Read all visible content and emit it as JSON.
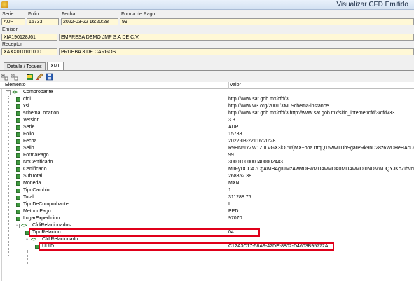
{
  "window": {
    "title": "Visualizar CFD Emitido"
  },
  "header": {
    "serie_label": "Serie",
    "serie_value": "AUP",
    "folio_label": "Folio",
    "folio_value": "15733",
    "fecha_label": "Fecha",
    "fecha_value": "2022-03-22 16:20:28",
    "forma_pago_label": "Forma de Pago",
    "forma_pago_value": "99",
    "emisor_label": "Emisor",
    "emisor_rfc": "XIA190128J61",
    "emisor_nombre": "EMPRESA DEMO JMP S.A DE C.V.",
    "receptor_label": "Receptor",
    "receptor_rfc": "XAXX010101000",
    "receptor_nombre": "PRUEBA 3  DE CARGOS"
  },
  "tabs": [
    {
      "label": "Detalle / Totales",
      "active": false
    },
    {
      "label": "XML",
      "active": true
    }
  ],
  "toolbar": {
    "icons": [
      "expand-all-icon",
      "collapse-all-icon",
      "open-icon",
      "edit-icon",
      "save-icon"
    ]
  },
  "grid": {
    "col_elemento": "Elemento",
    "col_valor": "Valor",
    "rows": [
      {
        "name": "Comprobante",
        "value": "",
        "type": "node"
      },
      {
        "name": "cfdi",
        "value": "http://www.sat.gob.mx/cfd/3",
        "type": "attr"
      },
      {
        "name": "xsi",
        "value": "http://www.w3.org/2001/XMLSchema-instance",
        "type": "attr"
      },
      {
        "name": "schemaLocation",
        "value": "http://www.sat.gob.mx/cfd/3 http://www.sat.gob.mx/sitio_internet/cfd/3/cfdv33.",
        "type": "attr"
      },
      {
        "name": "Version",
        "value": "3.3",
        "type": "attr"
      },
      {
        "name": "Serie",
        "value": "AUP",
        "type": "attr"
      },
      {
        "name": "Folio",
        "value": "15733",
        "type": "attr"
      },
      {
        "name": "Fecha",
        "value": "2022-03-22T16:20:28",
        "type": "attr"
      },
      {
        "name": "Sello",
        "value": "R9HN6IYZW1ZuLVGX3iO7w/jMX+boaTtrqQ15wwTDbSgarPRk9nD28z6WDHeHAcUQ",
        "type": "attr"
      },
      {
        "name": "FormaPago",
        "value": "99",
        "type": "attr"
      },
      {
        "name": "NoCertificado",
        "value": "30001000000400002443",
        "type": "attr"
      },
      {
        "name": "Certificado",
        "value": "MIIFyDCCA7CgAwIBAgIUMzAwMDEwMDAwMDA0MDAwMDI0NDMwDQYJKoZIhvcN",
        "type": "attr"
      },
      {
        "name": "SubTotal",
        "value": "268352.38",
        "type": "attr"
      },
      {
        "name": "Moneda",
        "value": "MXN",
        "type": "attr"
      },
      {
        "name": "TipoCambio",
        "value": "1",
        "type": "attr"
      },
      {
        "name": "Total",
        "value": "311288.76",
        "type": "attr"
      },
      {
        "name": "TipoDeComprobante",
        "value": "I",
        "type": "attr"
      },
      {
        "name": "MetodoPago",
        "value": "PPD",
        "type": "attr"
      },
      {
        "name": "LugarExpedicion",
        "value": "97070",
        "type": "attr"
      },
      {
        "name": "CfdiRelacionados",
        "value": "",
        "type": "node"
      },
      {
        "name": "TipoRelacion",
        "value": "04",
        "type": "attr"
      },
      {
        "name": "CfdiRelacionado",
        "value": "",
        "type": "node"
      },
      {
        "name": "UUID",
        "value": "C12A3C17-58A9-42DE-8802-D4603B95772A",
        "type": "attr"
      }
    ]
  }
}
